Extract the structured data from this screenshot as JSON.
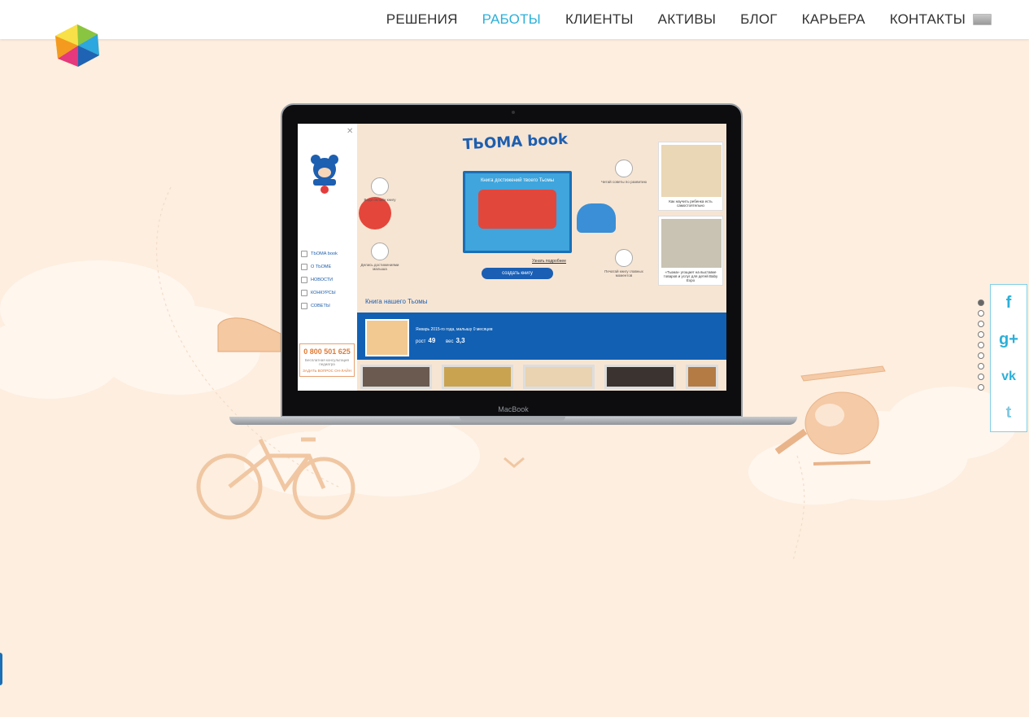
{
  "header": {
    "nav": [
      {
        "label": "РЕШЕНИЯ",
        "active": false
      },
      {
        "label": "РАБОТЫ",
        "active": true
      },
      {
        "label": "КЛИЕНТЫ",
        "active": false
      },
      {
        "label": "АКТИВЫ",
        "active": false
      },
      {
        "label": "БЛОГ",
        "active": false
      },
      {
        "label": "КАРЬЕРА",
        "active": false
      },
      {
        "label": "КОНТАКТЫ",
        "active": false
      }
    ],
    "accent_color": "#2bb0d9"
  },
  "laptop": {
    "brand": "MacBook",
    "site": {
      "title": "ТЬОМА book",
      "book_title": "Книга достижений твоего Тьомы",
      "create_button": "создать книгу",
      "more_link": "Узнать подробнее",
      "menu": [
        "ТЬОМА book",
        "О ТЬОМЕ",
        "НОВОСТИ",
        "КОНКУРСЫ",
        "СОВЕТЫ"
      ],
      "features": [
        "Веди онлайн книгу",
        "Делись достижениями малыша",
        "Читай советы по развитию",
        "Печатай книгу главных моментов"
      ],
      "cards": [
        "Как научить ребенка есть самостоятельно",
        "«Тьома» угощает на выставке товаров и услуг для детей Baby Expo"
      ],
      "section_title": "Книга нашего Тьомы",
      "entry_date": "Январь 2015-го года, малышу 0 месяцев",
      "height_label": "рост",
      "height_value": "49",
      "weight_label": "вес",
      "weight_value": "3,3",
      "phone": "0 800 501 625",
      "phone_note": "Бесплатная консультация педиатра",
      "phone_link": "ЗАДАТЬ ВОПРОС ОН-ЛАЙН"
    }
  },
  "social": {
    "icons": [
      "facebook-icon",
      "google-plus-icon",
      "vk-icon",
      "twitter-icon"
    ],
    "glyphs": [
      "f",
      "g+",
      "vk",
      "t"
    ]
  },
  "pager": {
    "count": 9,
    "active_index": 0
  }
}
